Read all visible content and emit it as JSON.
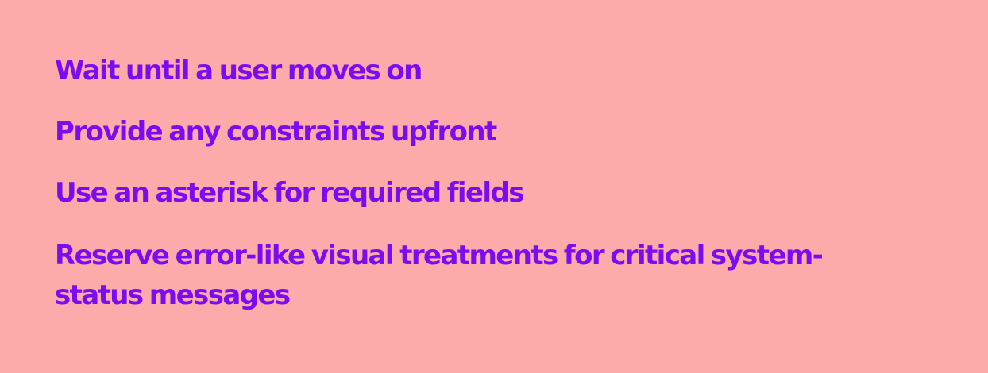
{
  "slide": {
    "background_color": "#fcaaaa",
    "text_color": "#7a0cf2",
    "items": [
      "Wait until a user moves on",
      "Provide any constraints upfront",
      "Use an asterisk for required fields",
      "Reserve error-like visual treatments for critical system-\nstatus messages"
    ]
  }
}
